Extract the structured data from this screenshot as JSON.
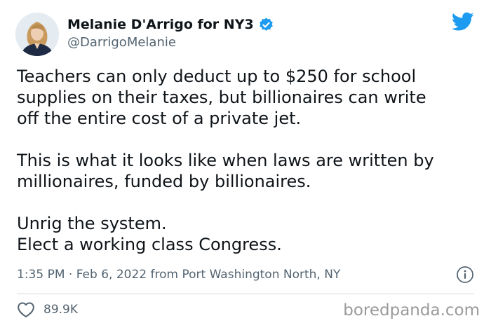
{
  "author": {
    "display_name": "Melanie D'Arrigo for NY3",
    "handle": "@DarrigoMelanie",
    "verified": true,
    "avatar_icon": "profile-photo"
  },
  "brand": {
    "icon": "twitter-bird-icon",
    "color": "#1d9bf0"
  },
  "tweet": {
    "lines": [
      "Teachers can only deduct up to $250 for school",
      "supplies on their taxes, but billionaires can write",
      "off the entire cost of a private jet.",
      "",
      "This is what it looks like when laws are written by",
      "millionaires, funded by billionaires.",
      "",
      "Unrig the system.",
      "Elect a working class Congress."
    ]
  },
  "meta": {
    "timestamp": "1:35 PM · Feb 6, 2022 from Port Washington North, NY",
    "info_icon": "info-icon"
  },
  "engagement": {
    "like_icon": "heart-icon",
    "likes": "89.9K"
  },
  "watermark": {
    "text": "boredpanda.com"
  },
  "colors": {
    "text_primary": "#0f1419",
    "text_secondary": "#536471",
    "verified_blue": "#1d9bf0",
    "divider": "#cfd9de"
  }
}
